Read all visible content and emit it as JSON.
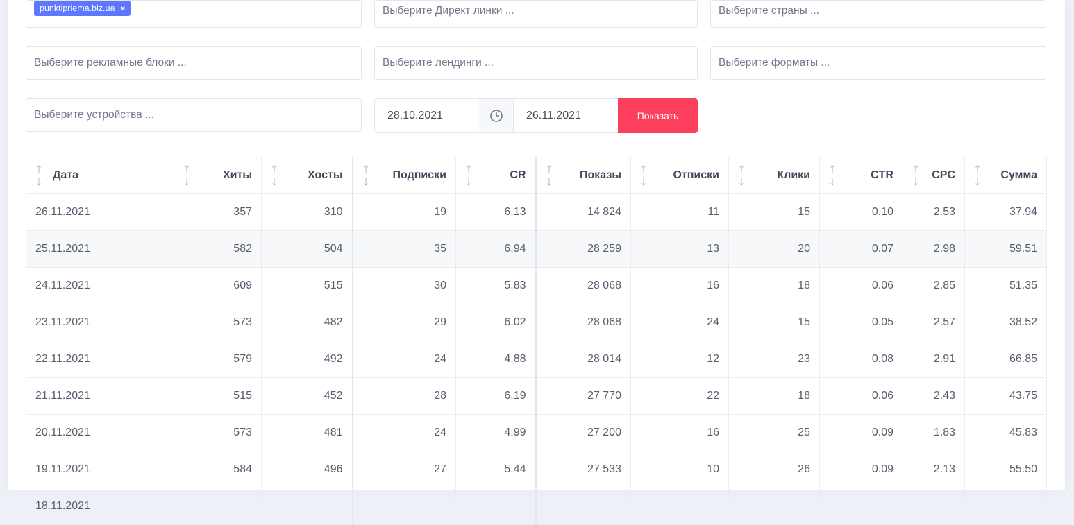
{
  "filters": {
    "tag": {
      "label": "punktipriema.biz.ua",
      "remove": "×"
    },
    "direct_links": "Выберите Директ линки ...",
    "countries": "Выберите страны ...",
    "ad_blocks": "Выберите рекламные блоки ...",
    "landings": "Выберите лендинги ...",
    "formats": "Выберите форматы ...",
    "devices": "Выберите устройства ...",
    "date_from": "28.10.2021",
    "date_to": "26.11.2021",
    "show_button": "Показать"
  },
  "table": {
    "headers": [
      "Дата",
      "Хиты",
      "Хосты",
      "Подписки",
      "CR",
      "Показы",
      "Отписки",
      "Клики",
      "CTR",
      "CPC",
      "Сумма"
    ],
    "rows": [
      [
        "26.11.2021",
        "357",
        "310",
        "19",
        "6.13",
        "14 824",
        "11",
        "15",
        "0.10",
        "2.53",
        "37.94"
      ],
      [
        "25.11.2021",
        "582",
        "504",
        "35",
        "6.94",
        "28 259",
        "13",
        "20",
        "0.07",
        "2.98",
        "59.51"
      ],
      [
        "24.11.2021",
        "609",
        "515",
        "30",
        "5.83",
        "28 068",
        "16",
        "18",
        "0.06",
        "2.85",
        "51.35"
      ],
      [
        "23.11.2021",
        "573",
        "482",
        "29",
        "6.02",
        "28 068",
        "24",
        "15",
        "0.05",
        "2.57",
        "38.52"
      ],
      [
        "22.11.2021",
        "579",
        "492",
        "24",
        "4.88",
        "28 014",
        "12",
        "23",
        "0.08",
        "2.91",
        "66.85"
      ],
      [
        "21.11.2021",
        "515",
        "452",
        "28",
        "6.19",
        "27 770",
        "22",
        "18",
        "0.06",
        "2.43",
        "43.75"
      ],
      [
        "20.11.2021",
        "573",
        "481",
        "24",
        "4.99",
        "27 200",
        "16",
        "25",
        "0.09",
        "1.83",
        "45.83"
      ],
      [
        "19.11.2021",
        "584",
        "496",
        "27",
        "5.44",
        "27 533",
        "10",
        "26",
        "0.09",
        "2.13",
        "55.50"
      ],
      [
        "18.11.2021",
        "",
        "",
        "",
        "",
        "",
        "",
        "",
        "",
        "",
        ""
      ]
    ]
  },
  "icons": {
    "clock": "clock-icon",
    "sort": "sort-arrows-icon"
  },
  "colors": {
    "accent": "#5d78ff",
    "show_button": "#fd3f5e"
  }
}
